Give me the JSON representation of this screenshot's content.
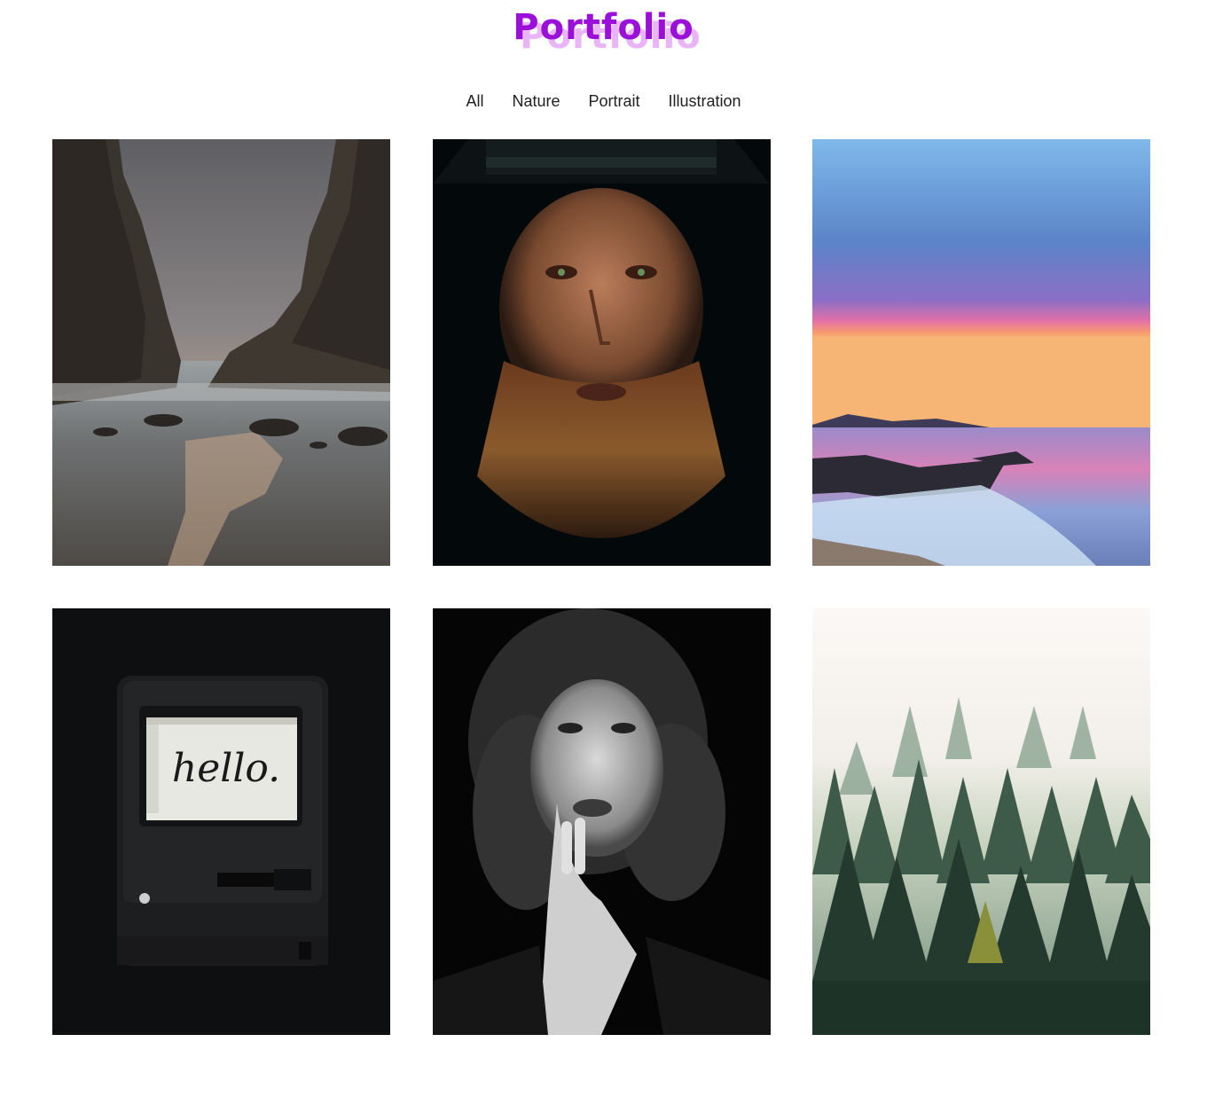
{
  "header": {
    "title": "Portfolio",
    "title_color": "#9b10d9",
    "title_shadow_color": "#e9b5f7"
  },
  "filters": [
    {
      "label": "All"
    },
    {
      "label": "Nature"
    },
    {
      "label": "Portrait"
    },
    {
      "label": "Illustration"
    }
  ],
  "gallery": {
    "items": [
      {
        "subject": "rocky beach cliffs at sunset"
      },
      {
        "subject": "bearded man in black hat"
      },
      {
        "subject": "pink sunset over sea and rocks"
      },
      {
        "subject": "retro computer with hello on screen",
        "screen_text": "hello."
      },
      {
        "subject": "black and white portrait of woman with curly hair"
      },
      {
        "subject": "misty pine forest"
      }
    ]
  }
}
